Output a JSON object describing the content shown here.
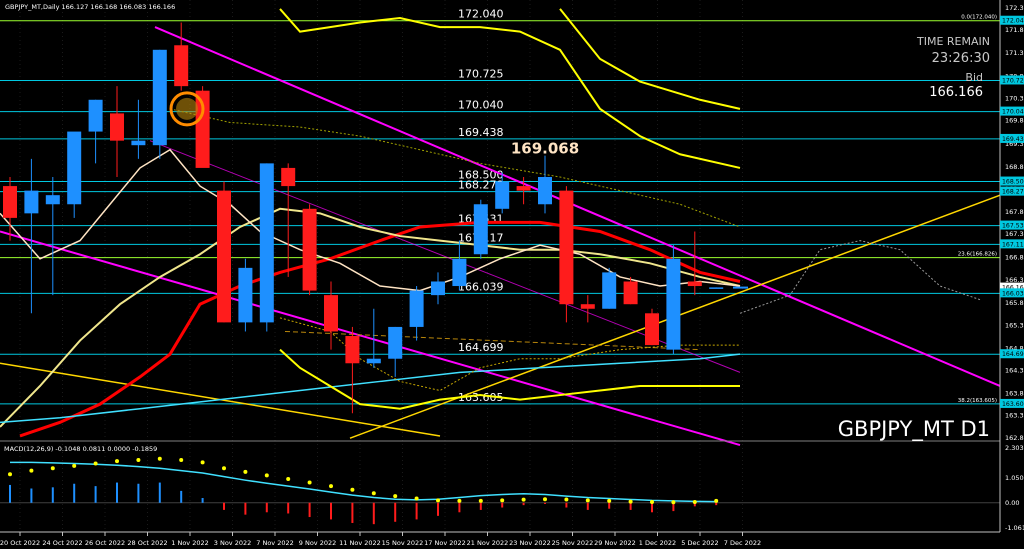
{
  "header": "GBPJPY_MT,Daily  166.127 166.168 166.083 166.166",
  "symbol_watermark": "GBPJPY_MT D1",
  "time_remain_label": "TIME REMAIN",
  "time_remain_value": "23:26:30",
  "bid_label": "Bid",
  "bid_value": "166.166",
  "callout": "169.068",
  "macd_header": "MACD(12,26,9) -0.1048 0.0811 0.0000 -0.1859",
  "colors": {
    "background": "#000000",
    "bull": "#1e90ff",
    "bear": "#ff1c1c",
    "level_line": "#00c8e0",
    "fib_line": "#9cff2f",
    "channel": "#ff00ff",
    "ma_fast": "#ff0000",
    "ma_slow": "#ffff00",
    "trendline": "#ffd700",
    "macd_signal": "#ffff00",
    "macd_line": "#40e0ff"
  },
  "chart_data": {
    "type": "candlestick",
    "title": "GBPJPY_MT D1",
    "ylim": [
      162.855,
      172.32
    ],
    "y_ticks": [
      "172.320",
      "171.835",
      "171.325",
      "170.815",
      "170.325",
      "169.840",
      "169.330",
      "168.820",
      "168.335",
      "167.830",
      "167.340",
      "166.825",
      "166.335",
      "165.830",
      "165.335",
      "164.830",
      "164.340",
      "163.830",
      "163.350",
      "162.855"
    ],
    "x_labels": [
      "20 Oct 2022",
      "24 Oct 2022",
      "26 Oct 2022",
      "28 Oct 2022",
      "1 Nov 2022",
      "3 Nov 2022",
      "7 Nov 2022",
      "9 Nov 2022",
      "11 Nov 2022",
      "15 Nov 2022",
      "17 Nov 2022",
      "21 Nov 2022",
      "23 Nov 2022",
      "25 Nov 2022",
      "29 Nov 2022",
      "1 Dec 2022",
      "5 Dec 2022",
      "7 Dec 2022"
    ],
    "candles": [
      {
        "o": 168.4,
        "h": 168.6,
        "l": 167.2,
        "c": 167.7
      },
      {
        "o": 167.8,
        "h": 169.0,
        "l": 165.6,
        "c": 168.3
      },
      {
        "o": 168.0,
        "h": 168.6,
        "l": 166.0,
        "c": 168.2
      },
      {
        "o": 168.0,
        "h": 169.5,
        "l": 167.7,
        "c": 169.6
      },
      {
        "o": 169.6,
        "h": 170.3,
        "l": 168.9,
        "c": 170.3
      },
      {
        "o": 170.0,
        "h": 170.6,
        "l": 168.6,
        "c": 169.4
      },
      {
        "o": 169.3,
        "h": 170.3,
        "l": 169.0,
        "c": 169.4
      },
      {
        "o": 169.3,
        "h": 171.4,
        "l": 169.0,
        "c": 171.4
      },
      {
        "o": 171.5,
        "h": 172.0,
        "l": 170.5,
        "c": 170.6
      },
      {
        "o": 170.5,
        "h": 170.6,
        "l": 169.2,
        "c": 168.8
      },
      {
        "o": 168.3,
        "h": 168.5,
        "l": 165.4,
        "c": 165.4
      },
      {
        "o": 165.4,
        "h": 166.8,
        "l": 165.2,
        "c": 166.6
      },
      {
        "o": 165.4,
        "h": 168.9,
        "l": 165.2,
        "c": 168.9
      },
      {
        "o": 168.8,
        "h": 168.9,
        "l": 166.4,
        "c": 168.4
      },
      {
        "o": 167.9,
        "h": 168.0,
        "l": 166.0,
        "c": 166.1
      },
      {
        "o": 166.0,
        "h": 166.3,
        "l": 164.8,
        "c": 165.2
      },
      {
        "o": 165.1,
        "h": 165.3,
        "l": 163.4,
        "c": 164.5
      },
      {
        "o": 164.5,
        "h": 165.7,
        "l": 164.4,
        "c": 164.6
      },
      {
        "o": 164.6,
        "h": 165.3,
        "l": 164.2,
        "c": 165.3
      },
      {
        "o": 165.3,
        "h": 166.2,
        "l": 165.0,
        "c": 166.1
      },
      {
        "o": 166.0,
        "h": 166.5,
        "l": 165.8,
        "c": 166.3
      },
      {
        "o": 166.2,
        "h": 167.2,
        "l": 166.1,
        "c": 166.8
      },
      {
        "o": 166.9,
        "h": 168.1,
        "l": 166.8,
        "c": 168.0
      },
      {
        "o": 167.9,
        "h": 168.7,
        "l": 167.8,
        "c": 168.5
      },
      {
        "o": 168.4,
        "h": 168.6,
        "l": 168.0,
        "c": 168.3
      },
      {
        "o": 168.0,
        "h": 169.07,
        "l": 167.8,
        "c": 168.6
      },
      {
        "o": 168.3,
        "h": 168.4,
        "l": 165.4,
        "c": 165.8
      },
      {
        "o": 165.8,
        "h": 166.0,
        "l": 165.4,
        "c": 165.7
      },
      {
        "o": 165.7,
        "h": 166.6,
        "l": 165.7,
        "c": 166.5
      },
      {
        "o": 166.3,
        "h": 166.4,
        "l": 165.8,
        "c": 165.8
      },
      {
        "o": 165.6,
        "h": 165.7,
        "l": 164.9,
        "c": 164.9
      },
      {
        "o": 164.8,
        "h": 167.1,
        "l": 164.7,
        "c": 166.8
      },
      {
        "o": 166.3,
        "h": 167.4,
        "l": 166.0,
        "c": 166.2
      },
      {
        "o": 166.17,
        "h": 166.17,
        "l": 166.16,
        "c": 166.17
      }
    ],
    "levels": [
      {
        "value": 172.04,
        "label": "172.040",
        "type": "fib"
      },
      {
        "value": 170.725,
        "label": "170.725",
        "type": "level"
      },
      {
        "value": 170.04,
        "label": "170.040",
        "type": "level"
      },
      {
        "value": 169.438,
        "label": "169.438",
        "type": "level"
      },
      {
        "value": 168.5,
        "label": "168.500",
        "type": "level"
      },
      {
        "value": 168.278,
        "label": "168.278",
        "type": "level"
      },
      {
        "value": 167.531,
        "label": "167.531",
        "type": "level"
      },
      {
        "value": 167.117,
        "label": "167.117",
        "type": "level"
      },
      {
        "value": 166.826,
        "label": "",
        "type": "fib"
      },
      {
        "value": 166.039,
        "label": "166.039",
        "type": "level"
      },
      {
        "value": 164.699,
        "label": "164.699",
        "type": "level"
      },
      {
        "value": 163.605,
        "label": "163.605",
        "type": "level"
      }
    ],
    "fib_labels": [
      {
        "value": 172.04,
        "label": "0.0(172.040)"
      },
      {
        "value": 166.826,
        "label": "23.6(166.826)"
      },
      {
        "value": 163.605,
        "label": "38.2(163.605)"
      }
    ],
    "axis_tags": [
      {
        "value": 172.04,
        "label": "172.040"
      },
      {
        "value": 170.725,
        "label": "170.725"
      },
      {
        "value": 170.04,
        "label": "170.040"
      },
      {
        "value": 169.438,
        "label": "169.438"
      },
      {
        "value": 168.5,
        "label": "168.500"
      },
      {
        "value": 168.278,
        "label": "168.278"
      },
      {
        "value": 167.531,
        "label": "167.531"
      },
      {
        "value": 167.117,
        "label": "167.117"
      },
      {
        "value": 166.166,
        "label": "166.166"
      },
      {
        "value": 166.039,
        "label": "166.039"
      },
      {
        "value": 164.699,
        "label": "164.699"
      },
      {
        "value": 163.605,
        "label": "163.605"
      }
    ],
    "macd": {
      "ylim": [
        -1.0611,
        2.3036
      ],
      "y_ticks": [
        "2.3036",
        "1.0500",
        "0.00",
        "-1.0611"
      ],
      "histogram": [
        0.75,
        0.6,
        0.65,
        0.8,
        0.7,
        0.85,
        0.8,
        0.85,
        0.5,
        0.2,
        -0.3,
        -0.5,
        -0.4,
        -0.45,
        -0.6,
        -0.7,
        -0.85,
        -0.9,
        -0.8,
        -0.7,
        -0.55,
        -0.4,
        -0.3,
        -0.2,
        -0.1,
        -0.05,
        -0.2,
        -0.3,
        -0.25,
        -0.3,
        -0.4,
        -0.35,
        -0.15,
        -0.1
      ],
      "signal": [
        1.2,
        1.35,
        1.45,
        1.55,
        1.65,
        1.75,
        1.8,
        1.85,
        1.8,
        1.7,
        1.45,
        1.3,
        1.15,
        1.0,
        0.85,
        0.7,
        0.55,
        0.4,
        0.28,
        0.18,
        0.1,
        0.08,
        0.08,
        0.1,
        0.13,
        0.15,
        0.14,
        0.1,
        0.08,
        0.05,
        0.03,
        0.02,
        0.03,
        0.08
      ],
      "line": [
        1.7,
        1.7,
        1.68,
        1.65,
        1.62,
        1.58,
        1.52,
        1.45,
        1.35,
        1.25,
        1.1,
        0.95,
        0.82,
        0.7,
        0.58,
        0.45,
        0.32,
        0.22,
        0.15,
        0.12,
        0.15,
        0.22,
        0.3,
        0.35,
        0.38,
        0.35,
        0.28,
        0.22,
        0.18,
        0.14,
        0.1,
        0.08,
        0.06,
        0.05
      ]
    }
  }
}
